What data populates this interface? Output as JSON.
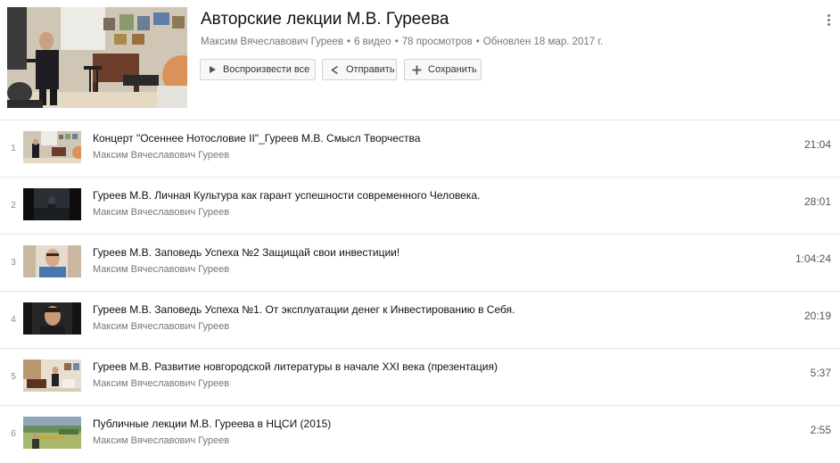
{
  "playlist": {
    "title": "Авторские лекции М.В. Гуреева",
    "owner": "Максим Вячеславович Гуреев",
    "video_count": "6 видео",
    "views": "78 просмотров",
    "updated": "Обновлен 18 мар. 2017 г.",
    "separator": "•"
  },
  "actions": {
    "play_all": "Воспроизвести все",
    "share": "Отправить",
    "save": "Сохранить"
  },
  "videos": [
    {
      "index": "1",
      "title": "Концерт \"Осеннее Нотословие II\"_Гуреев М.В. Смысл Творчества",
      "channel": "Максим Вячеславович Гуреев",
      "duration": "21:04"
    },
    {
      "index": "2",
      "title": "Гуреев М.В. Личная Культура как гарант успешности современного Человека.",
      "channel": "Максим Вячеславович Гуреев",
      "duration": "28:01"
    },
    {
      "index": "3",
      "title": "Гуреев М.В. Заповедь Успеха №2 Защищай свои инвестиции!",
      "channel": "Максим Вячеславович Гуреев",
      "duration": "1:04:24"
    },
    {
      "index": "4",
      "title": "Гуреев М.В. Заповедь Успеха №1. От эксплуатации денег к Инвестированию в Себя.",
      "channel": "Максим Вячеславович Гуреев",
      "duration": "20:19"
    },
    {
      "index": "5",
      "title": "Гуреев М.В. Развитие новгородской литературы в начале XXI века (презентация)",
      "channel": "Максим Вячеславович Гуреев",
      "duration": "5:37"
    },
    {
      "index": "6",
      "title": "Публичные лекции М.В. Гуреева в НЦСИ (2015)",
      "channel": "Максим Вячеславович Гуреев",
      "duration": "2:55"
    }
  ],
  "icons": {
    "play": "play-icon",
    "share": "share-icon",
    "save": "plus-icon",
    "menu": "kebab-menu-icon"
  },
  "colors": {
    "text_primary": "#111111",
    "text_secondary": "#767676",
    "divider": "#e6e6e6",
    "button_bg": "#f8f8f8"
  }
}
